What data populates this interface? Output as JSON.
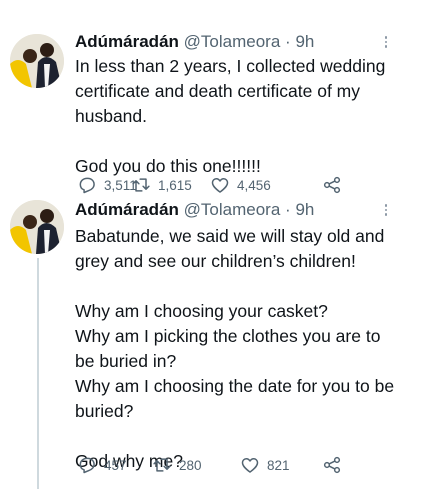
{
  "tweets": [
    {
      "author": {
        "name": "Adúmáradán",
        "handle": "@Tolameora",
        "separator": "·",
        "time": "9h"
      },
      "text": "In less than 2 years, I collected wedding\ncertificate and death certificate of my\nhusband.\n\nGod you do this one!!!!!!",
      "stats": {
        "replies": "3,511",
        "retweets": "1,615",
        "likes": "4,456"
      }
    },
    {
      "author": {
        "name": "Adúmáradán",
        "handle": "@Tolameora",
        "separator": "·",
        "time": "9h"
      },
      "text": "Babatunde, we said we will stay old and\ngrey and see our children’s children!\n\nWhy am I choosing your casket?\nWhy am I picking the clothes you are to\nbe buried in?\nWhy am I choosing the date for you to be\nburied?\n\nGod why me?",
      "stats": {
        "replies": "457",
        "retweets": "280",
        "likes": "821"
      }
    }
  ],
  "icons": {
    "reply": "reply-icon",
    "retweet": "retweet-icon",
    "like": "like-icon",
    "share": "share-icon",
    "more": "more-icon"
  },
  "colors": {
    "text": "#0f1419",
    "secondary": "#536471",
    "thread_line": "#cfd9de"
  }
}
